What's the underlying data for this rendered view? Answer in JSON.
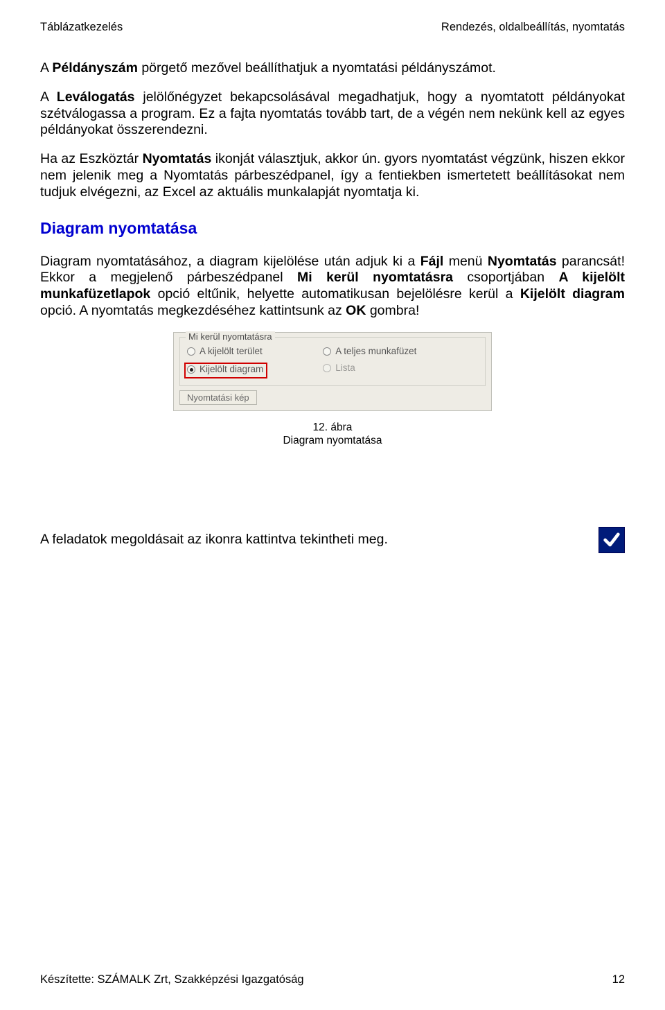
{
  "header": {
    "left": "Táblázatkezelés",
    "right": "Rendezés, oldalbeállítás, nyomtatás"
  },
  "paragraphs": {
    "p1_a": "A ",
    "p1_b": "Példányszám",
    "p1_c": " pörgető mezővel beállíthatjuk a nyomtatási példányszámot.",
    "p2_a": "A ",
    "p2_b": "Leválogatás",
    "p2_c": " jelölőnégyzet bekapcsolásával megadhatjuk, hogy a nyomtatott példányokat szétválogassa a program. Ez a fajta nyomtatás tovább tart, de a végén nem nekünk kell az egyes példányokat összerendezni.",
    "p3_a": "Ha az Eszköztár ",
    "p3_b": "Nyomtatás",
    "p3_c": " ikonját választjuk, akkor ún. gyors nyomtatást végzünk, hiszen ekkor nem jelenik meg a Nyomtatás párbeszédpanel, így a fentiekben ismertetett beállításokat nem tudjuk elvégezni, az Excel az aktuális munkalapját nyomtatja ki."
  },
  "section_heading": "Diagram nyomtatása",
  "diagram_para": {
    "t1": "Diagram nyomtatásához, a diagram kijelölése után adjuk ki a ",
    "b1": "Fájl",
    "t2": " menü ",
    "b2": "Nyomtatás",
    "t3": " parancsát! Ekkor a megjelenő párbeszédpanel ",
    "b3": "Mi kerül nyomtatásra",
    "t4": " csoportjában ",
    "b4": "A kijelölt munkafüzetlapok",
    "t5": " opció eltűnik, helyette automatikusan bejelölésre kerül a ",
    "b5": "Kijelölt diagram",
    "t6": " opció. A nyomtatás megkezdéséhez kattintsunk az ",
    "b6": "OK",
    "t7": " gombra!"
  },
  "dialog": {
    "legend": "Mi kerül nyomtatásra",
    "opt_area": "A kijelölt terület",
    "opt_workbook": "A teljes munkafüzet",
    "opt_diagram": "Kijelölt diagram",
    "opt_list": "Lista",
    "preview_btn": "Nyomtatási kép"
  },
  "caption": {
    "line1": "12. ábra",
    "line2": "Diagram nyomtatása"
  },
  "solutions_text": "A feladatok megoldásait az ikonra kattintva tekintheti meg.",
  "footer": {
    "left": "Készítette: SZÁMALK Zrt, Szakképzési Igazgatóság",
    "page": "12"
  }
}
